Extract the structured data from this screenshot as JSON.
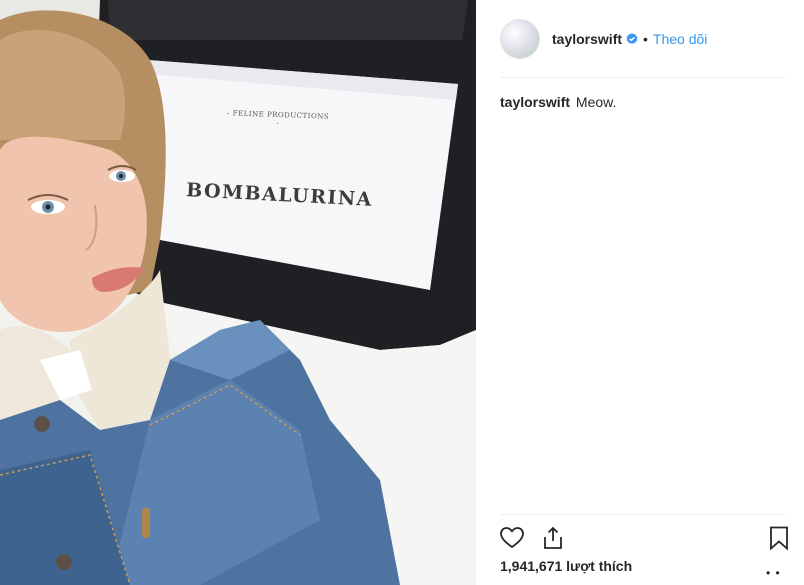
{
  "post": {
    "photo": {
      "description_icon": "photo",
      "sign_small_text": "- FELINE PRODUCTIONS -",
      "sign_main_text": "BOMBALURINA"
    },
    "header": {
      "username": "taylorswift",
      "verified_icon": "verified-badge-icon",
      "separator": "•",
      "follow_label": "Theo dõi"
    },
    "caption": {
      "username": "taylorswift",
      "text": "Meow."
    },
    "actions": {
      "like_icon": "heart-icon",
      "share_icon": "share-icon",
      "save_icon": "bookmark-icon"
    },
    "likes_text": "1,941,671 lượt thích",
    "more_text": "• •",
    "colors": {
      "link": "#3897f0",
      "text": "#262626",
      "divider": "#efefef"
    }
  }
}
